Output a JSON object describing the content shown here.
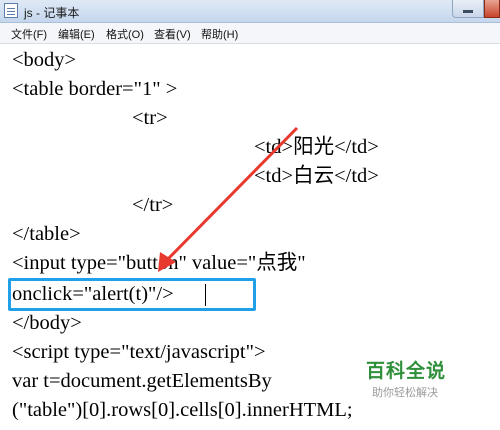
{
  "window": {
    "title": "js - 记事本"
  },
  "menu": {
    "file": "文件(F)",
    "edit": "编辑(E)",
    "format": "格式(O)",
    "view": "查看(V)",
    "help": "帮助(H)"
  },
  "editor": {
    "lines": [
      "<body>",
      "<table border=\"1\" >",
      "<tr>",
      "<td>阳光</td>",
      "<td>白云</td>",
      "</tr>",
      "</table>",
      "<input type=\"button\" value=\"点我\"",
      "onclick=\"alert(t)\"/>",
      "</body>",
      "<script type=\"text/javascript\">",
      "var t=document.getElementsBy",
      "(\"table\")[0].rows[0].cells[0].innerHTML;"
    ]
  },
  "annotation": {
    "arrow_color": "#e8392e",
    "box_color": "#1fa0e8"
  },
  "watermark": {
    "title": "百科全说",
    "subtitle": "助你轻松解决"
  }
}
